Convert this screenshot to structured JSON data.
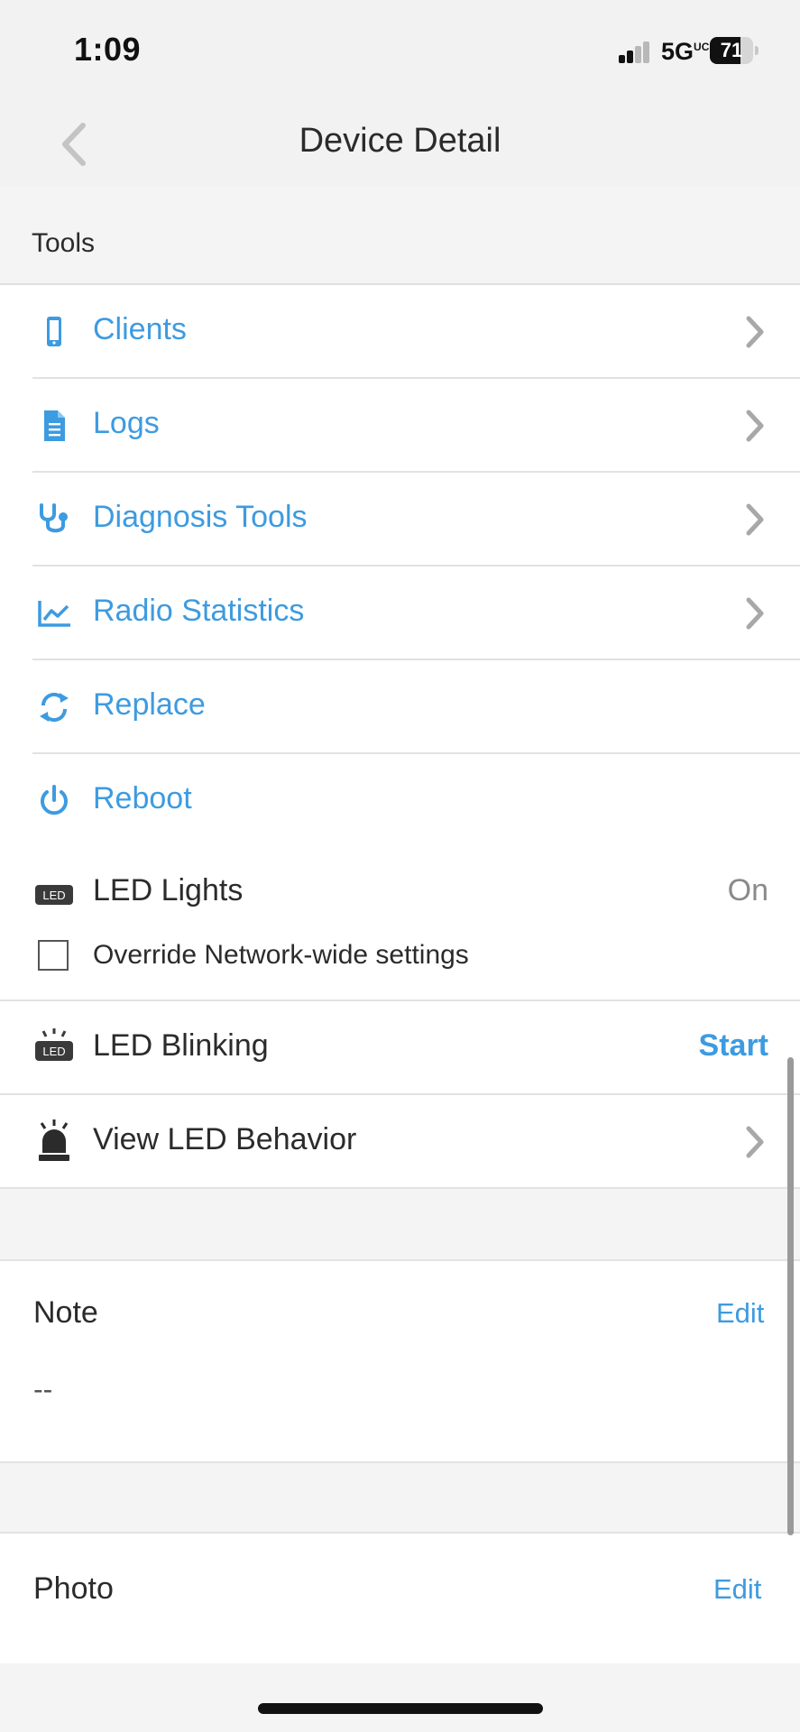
{
  "status_bar": {
    "time": "1:09",
    "network": "5G",
    "network_sup": "UC",
    "battery": "71",
    "battery_level_percent": 71
  },
  "nav": {
    "title": "Device Detail",
    "back_icon": "chevron-left-icon"
  },
  "tools_section": {
    "header": "Tools",
    "items": [
      {
        "label": "Clients",
        "icon": "phone-icon",
        "has_chevron": true
      },
      {
        "label": "Logs",
        "icon": "document-icon",
        "has_chevron": true
      },
      {
        "label": "Diagnosis Tools",
        "icon": "stethoscope-icon",
        "has_chevron": true
      },
      {
        "label": "Radio Statistics",
        "icon": "line-chart-icon",
        "has_chevron": true
      },
      {
        "label": "Replace",
        "icon": "replace-icon",
        "has_chevron": false
      },
      {
        "label": "Reboot",
        "icon": "power-icon",
        "has_chevron": false
      }
    ]
  },
  "led_lights": {
    "label": "LED Lights",
    "value": "On",
    "icon_text": "LED",
    "override_label": "Override Network-wide settings",
    "override_checked": false
  },
  "led_blinking": {
    "label": "LED Blinking",
    "action": "Start",
    "icon_text": "LED"
  },
  "led_behavior": {
    "label": "View LED Behavior",
    "icon": "siren-icon"
  },
  "note": {
    "title": "Note",
    "edit": "Edit",
    "value": "--"
  },
  "photo": {
    "title": "Photo",
    "edit": "Edit"
  },
  "colors": {
    "accent": "#3d9be0",
    "text": "#2b2b2b",
    "muted": "#8a8a8a",
    "background": "#f4f4f4"
  }
}
